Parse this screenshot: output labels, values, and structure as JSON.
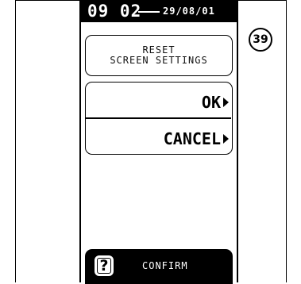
{
  "status": {
    "time": "09 02",
    "date": "29/08/01"
  },
  "title": {
    "line1": "RESET",
    "line2": "SCREEN SETTINGS"
  },
  "menu": {
    "ok_label": "OK",
    "cancel_label": "CANCEL"
  },
  "footer": {
    "help_symbol": "?",
    "confirm_label": "CONFIRM"
  },
  "step": {
    "number": "39"
  }
}
